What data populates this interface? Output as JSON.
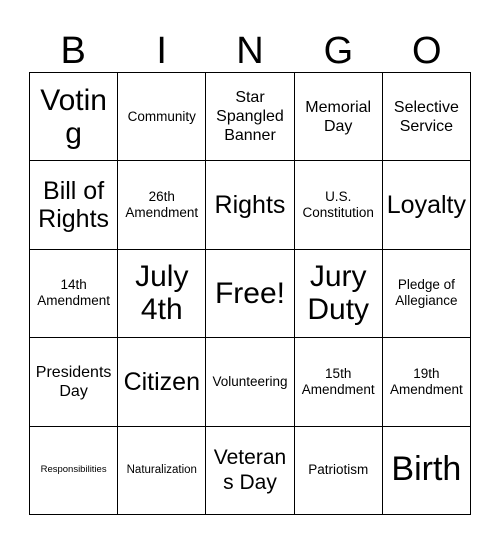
{
  "card": {
    "title_letters": [
      "B",
      "I",
      "N",
      "G",
      "O"
    ],
    "grid_size": "5x5",
    "text_color": "#000000",
    "background_color": "#ffffff",
    "border_color": "#000000",
    "cells": [
      [
        {
          "label": "Voting",
          "size": "fs-3xl"
        },
        {
          "label": "Community",
          "size": "fs-md"
        },
        {
          "label": "Star Spangled Banner",
          "size": "fs-lg"
        },
        {
          "label": "Memorial Day",
          "size": "fs-lg"
        },
        {
          "label": "Selective Service",
          "size": "fs-lg"
        }
      ],
      [
        {
          "label": "Bill of Rights",
          "size": "fs-2xl"
        },
        {
          "label": "26th Amendment",
          "size": "fs-md"
        },
        {
          "label": "Rights",
          "size": "fs-2xl"
        },
        {
          "label": "U.S. Constitution",
          "size": "fs-md"
        },
        {
          "label": "Loyalty",
          "size": "fs-2xl"
        }
      ],
      [
        {
          "label": "14th Amendment",
          "size": "fs-md"
        },
        {
          "label": "July 4th",
          "size": "fs-3xl"
        },
        {
          "label": "Free!",
          "size": "fs-3xl"
        },
        {
          "label": "Jury Duty",
          "size": "fs-3xl"
        },
        {
          "label": "Pledge of Allegiance",
          "size": "fs-md"
        }
      ],
      [
        {
          "label": "Presidents Day",
          "size": "fs-lg"
        },
        {
          "label": "Citizen",
          "size": "fs-2xl"
        },
        {
          "label": "Volunteering",
          "size": "fs-md"
        },
        {
          "label": "15th Amendment",
          "size": "fs-md"
        },
        {
          "label": "19th Amendment",
          "size": "fs-md"
        }
      ],
      [
        {
          "label": "Responsibilities",
          "size": "fs-xs"
        },
        {
          "label": "Naturalization",
          "size": "fs-sm"
        },
        {
          "label": "Veterans Day",
          "size": "fs-xl"
        },
        {
          "label": "Patriotism",
          "size": "fs-md"
        },
        {
          "label": "Birth",
          "size": "fs-4xl"
        }
      ]
    ]
  }
}
